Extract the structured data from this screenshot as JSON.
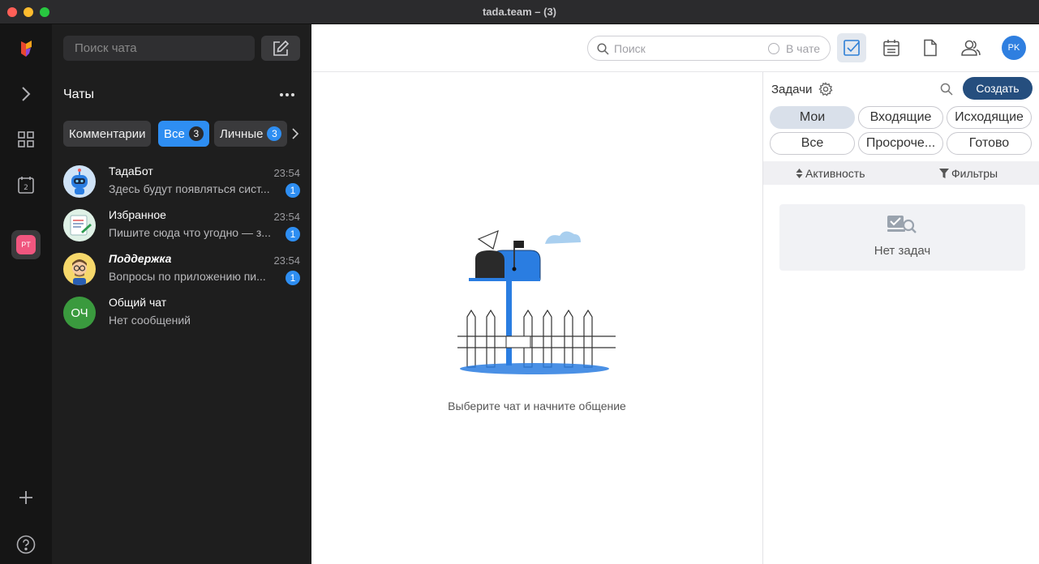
{
  "window": {
    "title": "tada.team – (3)"
  },
  "workspace": {
    "initials": "PT"
  },
  "sidebar": {
    "search_placeholder": "Поиск чата",
    "title": "Чаты",
    "filters": [
      {
        "label": "Комментарии"
      },
      {
        "label": "Все",
        "count": "3"
      },
      {
        "label": "Личные",
        "count": "3"
      }
    ],
    "chats": [
      {
        "name": "ТадаБот",
        "time": "23:54",
        "preview": "Здесь будут появляться сист...",
        "unread": "1"
      },
      {
        "name": "Избранное",
        "time": "23:54",
        "preview": "Пишите сюда что угодно — з...",
        "unread": "1"
      },
      {
        "name": "Поддержка",
        "time": "23:54",
        "preview": "Вопросы по приложению пи...",
        "unread": "1"
      },
      {
        "name": "Общий чат",
        "initials": "ОЧ",
        "preview": "Нет сообщений"
      }
    ]
  },
  "topbar": {
    "search_placeholder": "Поиск",
    "search_scope": "В чате",
    "user_initials": "PK"
  },
  "main": {
    "empty_text": "Выберите чат и начните общение"
  },
  "tasks": {
    "title": "Задачи",
    "create_label": "Создать",
    "tabs": [
      "Мои",
      "Входящие",
      "Исходящие",
      "Все",
      "Просроче...",
      "Готово"
    ],
    "sort_label": "Активность",
    "filter_label": "Фильтры",
    "empty_label": "Нет задач"
  },
  "colors": {
    "accent": "#2e8ef2",
    "create_button": "#254e7e",
    "workspace_avatar": "#f0567f",
    "group_avatar": "#3a9a3e"
  }
}
